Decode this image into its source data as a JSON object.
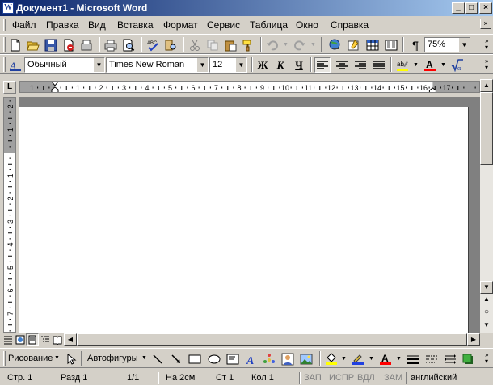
{
  "window": {
    "title": "Документ1 - Microsoft Word",
    "app_icon": "word-icon",
    "controls": [
      "minimize-icon",
      "maximize-icon",
      "close-icon"
    ]
  },
  "menu": {
    "items": [
      {
        "label": "Файл"
      },
      {
        "label": "Правка"
      },
      {
        "label": "Вид"
      },
      {
        "label": "Вставка"
      },
      {
        "label": "Формат"
      },
      {
        "label": "Сервис"
      },
      {
        "label": "Таблица"
      },
      {
        "label": "Окно"
      },
      {
        "label": "Справка"
      }
    ],
    "doc_close": "close-icon"
  },
  "standard_toolbar": {
    "zoom": "75%",
    "buttons": [
      "new-icon",
      "open-icon",
      "save-icon",
      "permission-icon",
      "email-icon",
      "print-icon",
      "print-preview-icon",
      "spelling-icon",
      "research-icon",
      "cut-icon",
      "copy-icon",
      "paste-icon",
      "format-painter-icon",
      "undo-icon",
      "redo-icon",
      "hyperlink-icon",
      "tables-borders-icon",
      "insert-table-icon",
      "columns-icon",
      "show-formatting-icon"
    ]
  },
  "formatting_toolbar": {
    "style": "Обычный",
    "font": "Times New Roman",
    "size": "12",
    "bold": "Ж",
    "italic": "К",
    "underline": "Ч",
    "alignment_selected": "left",
    "highlight_color": "#ffff00",
    "font_color": "#ff0000"
  },
  "ruler": {
    "tab_selector": "L",
    "numbers": [
      "1",
      "1",
      "2",
      "3",
      "4",
      "5",
      "6",
      "7",
      "8",
      "9",
      "10",
      "11",
      "12",
      "13",
      "14",
      "15",
      "16",
      "17"
    ],
    "vnumbers": [
      "2",
      "1",
      "1",
      "2",
      "3",
      "4",
      "5",
      "6",
      "7"
    ]
  },
  "drawing_toolbar": {
    "draw_label": "Рисование",
    "autoshapes_label": "Автофигуры"
  },
  "status": {
    "page": "Стр. 1",
    "section": "Разд 1",
    "pages": "1/1",
    "at": "На 2см",
    "line": "Ст 1",
    "col": "Кол 1",
    "rec": "ЗАП",
    "trk": "ИСПР",
    "ext": "ВДЛ",
    "ovr": "ЗАМ",
    "language": "английский"
  }
}
